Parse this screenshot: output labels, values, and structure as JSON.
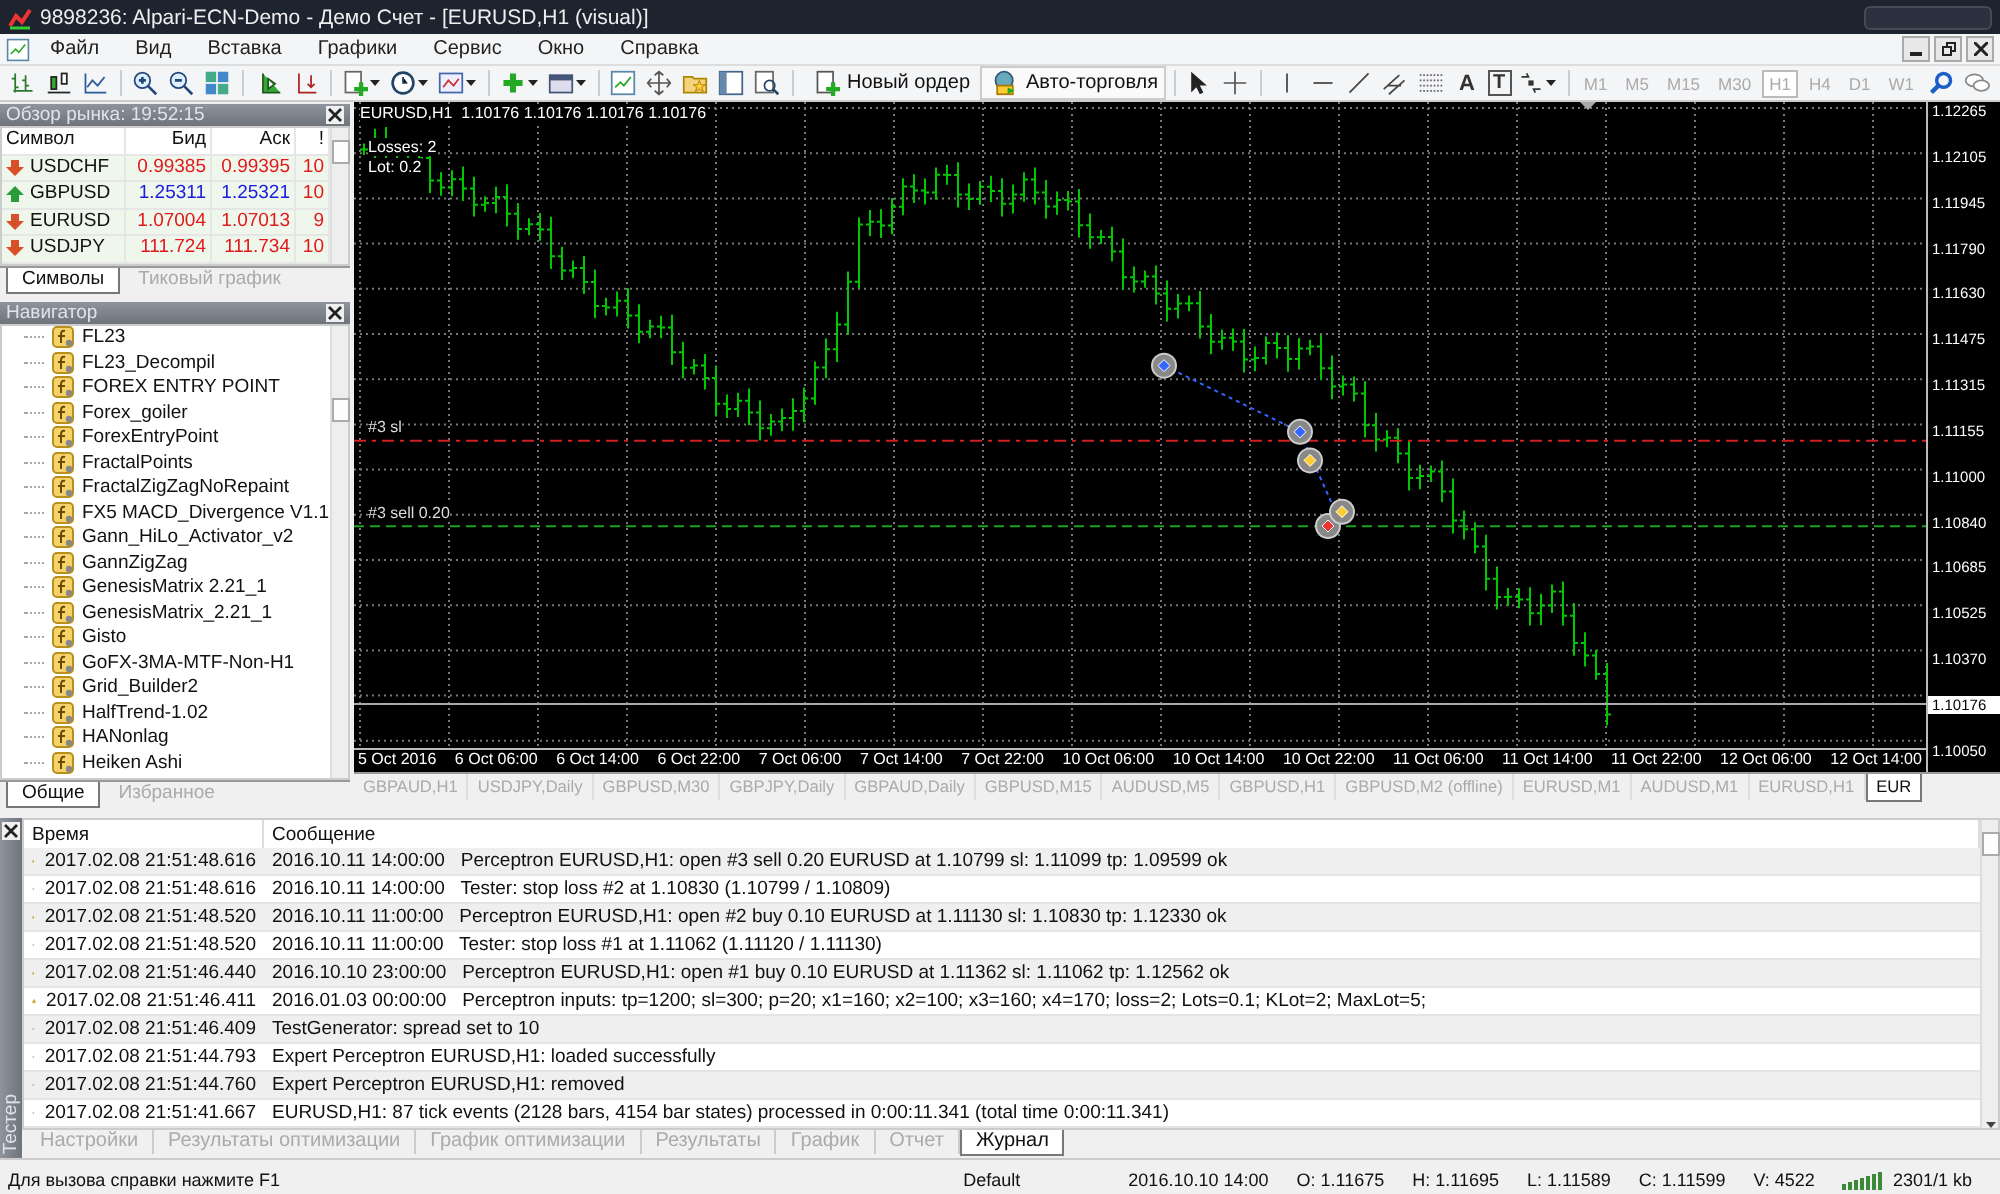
{
  "window": {
    "title": "9898236: Alpari-ECN-Demo - Демо Счет - [EURUSD,H1 (visual)]"
  },
  "menu": [
    "Файл",
    "Вид",
    "Вставка",
    "Графики",
    "Сервис",
    "Окно",
    "Справка"
  ],
  "toolbar": {
    "new_order": "Новый ордер",
    "auto_trading": "Авто-торговля",
    "text_tool": "A",
    "label_tool": "T",
    "timeframes": [
      {
        "label": "M1",
        "selected": false
      },
      {
        "label": "M5",
        "selected": false
      },
      {
        "label": "M15",
        "selected": false
      },
      {
        "label": "M30",
        "selected": false
      },
      {
        "label": "H1",
        "selected": true
      },
      {
        "label": "H4",
        "selected": false
      },
      {
        "label": "D1",
        "selected": false
      },
      {
        "label": "W1",
        "selected": false
      }
    ]
  },
  "market_watch": {
    "title": "Обзор рынка: 19:52:15",
    "columns": [
      "Символ",
      "Бид",
      "Аск",
      "!"
    ],
    "rows": [
      {
        "symbol": "USDCHF",
        "bid": "0.99385",
        "ask": "0.99395",
        "spread": "10",
        "up": false
      },
      {
        "symbol": "GBPUSD",
        "bid": "1.25311",
        "ask": "1.25321",
        "spread": "10",
        "up": true
      },
      {
        "symbol": "EURUSD",
        "bid": "1.07004",
        "ask": "1.07013",
        "spread": "9",
        "up": false
      },
      {
        "symbol": "USDJPY",
        "bid": "111.724",
        "ask": "111.734",
        "spread": "10",
        "up": false
      }
    ],
    "tabs": [
      {
        "label": "Символы",
        "selected": true
      },
      {
        "label": "Тиковый график",
        "selected": false
      }
    ]
  },
  "navigator": {
    "title": "Навигатор",
    "items": [
      "FL23",
      "FL23_Decompil",
      "FOREX ENTRY POINT",
      "Forex_goiler",
      "ForexEntryPoint",
      "FractalPoints",
      "FractalZigZagNoRepaint",
      "FX5 MACD_Divergence V1.1",
      "Gann_HiLo_Activator_v2",
      "GannZigZag",
      "GenesisMatrix 2.21_1",
      "GenesisMatrix_2.21_1",
      "Gisto",
      "GoFX-3MA-MTF-Non-H1",
      "Grid_Builder2",
      "HalfTrend-1.02",
      "HANonlag",
      "Heiken Ashi"
    ],
    "tabs": [
      {
        "label": "Общие",
        "selected": true
      },
      {
        "label": "Избранное",
        "selected": false
      }
    ]
  },
  "chart": {
    "header": "EURUSD,H1  1.10176 1.10176 1.10176 1.10176",
    "info": [
      "Losses: 2",
      "Lot: 0.2"
    ],
    "lines": [
      {
        "label": "#3 sl",
        "kind": "stop_loss"
      },
      {
        "label": "#3 sell 0.20",
        "kind": "order"
      }
    ],
    "price_labels": [
      "1.12265",
      "1.12105",
      "1.11945",
      "1.11790",
      "1.11630",
      "1.11475",
      "1.11315",
      "1.11155",
      "1.11000",
      "1.10840",
      "1.10685",
      "1.10525",
      "1.10370"
    ],
    "current_price": "1.10176",
    "bottom_price": "1.10050",
    "time_labels": [
      "5 Oct 2016",
      "6 Oct 06:00",
      "6 Oct 14:00",
      "6 Oct 22:00",
      "7 Oct 06:00",
      "7 Oct 14:00",
      "7 Oct 22:00",
      "10 Oct 06:00",
      "10 Oct 14:00",
      "10 Oct 22:00",
      "11 Oct 06:00",
      "11 Oct 14:00",
      "11 Oct 22:00",
      "12 Oct 06:00",
      "12 Oct 14:00"
    ]
  },
  "chart_tabs": [
    {
      "label": "GBPAUD,H1",
      "selected": false
    },
    {
      "label": "USDJPY,Daily",
      "selected": false
    },
    {
      "label": "GBPUSD,M30",
      "selected": false
    },
    {
      "label": "GBPJPY,Daily",
      "selected": false
    },
    {
      "label": "GBPAUD,Daily",
      "selected": false
    },
    {
      "label": "GBPUSD,M15",
      "selected": false
    },
    {
      "label": "AUDUSD,M5",
      "selected": false
    },
    {
      "label": "GBPUSD,H1",
      "selected": false
    },
    {
      "label": "GBPUSD,M2 (offline)",
      "selected": false
    },
    {
      "label": "EURUSD,M1",
      "selected": false
    },
    {
      "label": "AUDUSD,M1",
      "selected": false
    },
    {
      "label": "EURUSD,H1",
      "selected": false
    },
    {
      "label": "EUR",
      "selected": true
    }
  ],
  "terminal": {
    "side_label": "Тестер",
    "columns": [
      "Время",
      "Сообщение"
    ],
    "rows": [
      {
        "kind": "warning",
        "time": "2017.02.08 21:51:48.616",
        "message": "2016.10.11 14:00:00   Perceptron EURUSD,H1: open #3 sell 0.20 EURUSD at 1.10799 sl: 1.11099 tp: 1.09599 ok"
      },
      {
        "kind": "info",
        "time": "2017.02.08 21:51:48.616",
        "message": "2016.10.11 14:00:00   Tester: stop loss #2 at 1.10830 (1.10799 / 1.10809)"
      },
      {
        "kind": "warning",
        "time": "2017.02.08 21:51:48.520",
        "message": "2016.10.11 11:00:00   Perceptron EURUSD,H1: open #2 buy 0.10 EURUSD at 1.11130 sl: 1.10830 tp: 1.12330 ok"
      },
      {
        "kind": "info",
        "time": "2017.02.08 21:51:48.520",
        "message": "2016.10.11 11:00:00   Tester: stop loss #1 at 1.11062 (1.11120 / 1.11130)"
      },
      {
        "kind": "warning",
        "time": "2017.02.08 21:51:46.440",
        "message": "2016.10.10 23:00:00   Perceptron EURUSD,H1: open #1 buy 0.10 EURUSD at 1.11362 sl: 1.11062 tp: 1.12562 ok"
      },
      {
        "kind": "warning",
        "time": "2017.02.08 21:51:46.411",
        "message": "2016.01.03 00:00:00   Perceptron inputs: tp=1200; sl=300; p=20; x1=160; x2=100; x3=160; x4=170; loss=2; Lots=0.1; KLot=2; MaxLot=5;"
      },
      {
        "kind": "info",
        "time": "2017.02.08 21:51:46.409",
        "message": "TestGenerator: spread set to 10"
      },
      {
        "kind": "info",
        "time": "2017.02.08 21:51:44.793",
        "message": "Expert Perceptron EURUSD,H1: loaded successfully"
      },
      {
        "kind": "info",
        "time": "2017.02.08 21:51:44.760",
        "message": "Expert Perceptron EURUSD,H1: removed"
      },
      {
        "kind": "info",
        "time": "2017.02.08 21:51:41.667",
        "message": "EURUSD,H1: 87 tick events (2128 bars, 4154 bar states) processed in 0:00:11.341 (total time 0:00:11.341)"
      }
    ],
    "tabs": [
      {
        "label": "Настройки",
        "selected": false
      },
      {
        "label": "Результаты оптимизации",
        "selected": false
      },
      {
        "label": "График оптимизации",
        "selected": false
      },
      {
        "label": "Результаты",
        "selected": false
      },
      {
        "label": "График",
        "selected": false
      },
      {
        "label": "Отчет",
        "selected": false
      },
      {
        "label": "Журнал",
        "selected": true
      }
    ]
  },
  "status_bar": {
    "help": "Для вызова справки нажмите F1",
    "profile": "Default",
    "time": "2016.10.10 14:00",
    "open": "O: 1.11675",
    "high": "H: 1.11695",
    "low": "L: 1.11589",
    "close": "C: 1.11599",
    "volume": "V: 4522",
    "traffic": "2301/1 kb"
  }
}
